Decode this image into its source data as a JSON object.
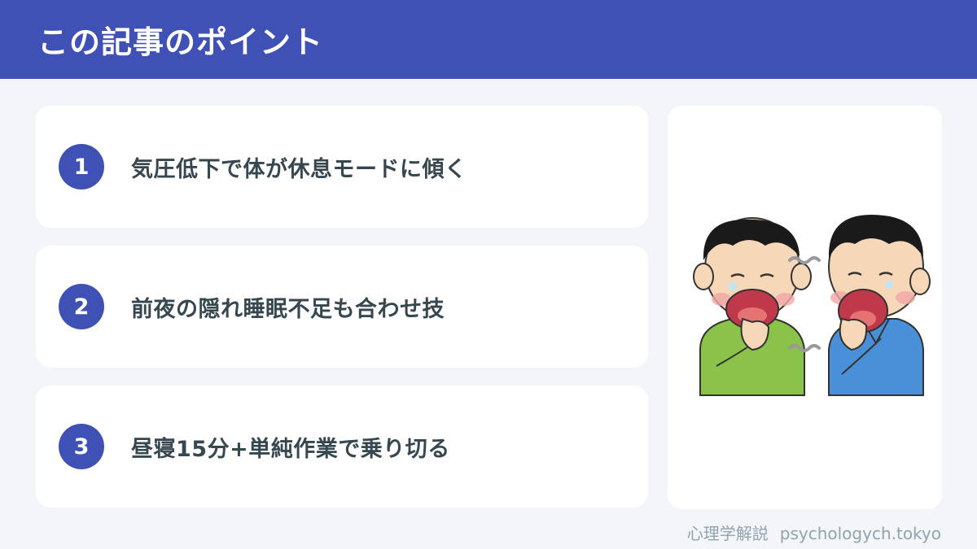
{
  "header": {
    "title": "この記事のポイント"
  },
  "points": [
    {
      "number": "1",
      "text": "気圧低下で体が休息モードに傾く"
    },
    {
      "number": "2",
      "text": "前夜の隠れ睡眠不足も合わせ技"
    },
    {
      "number": "3",
      "text": "昼寝15分+単純作業で乗り切る"
    }
  ],
  "illustration": {
    "subject": "two-men-yawning",
    "shirt_colors": [
      "#8bc34a",
      "#4a90d9"
    ]
  },
  "footer": {
    "label": "心理学解説",
    "site": "psychologych.tokyo"
  },
  "colors": {
    "accent": "#3f51b5",
    "background": "#f3f5f9",
    "text": "#37474f",
    "footer_text": "#90a4ae"
  }
}
